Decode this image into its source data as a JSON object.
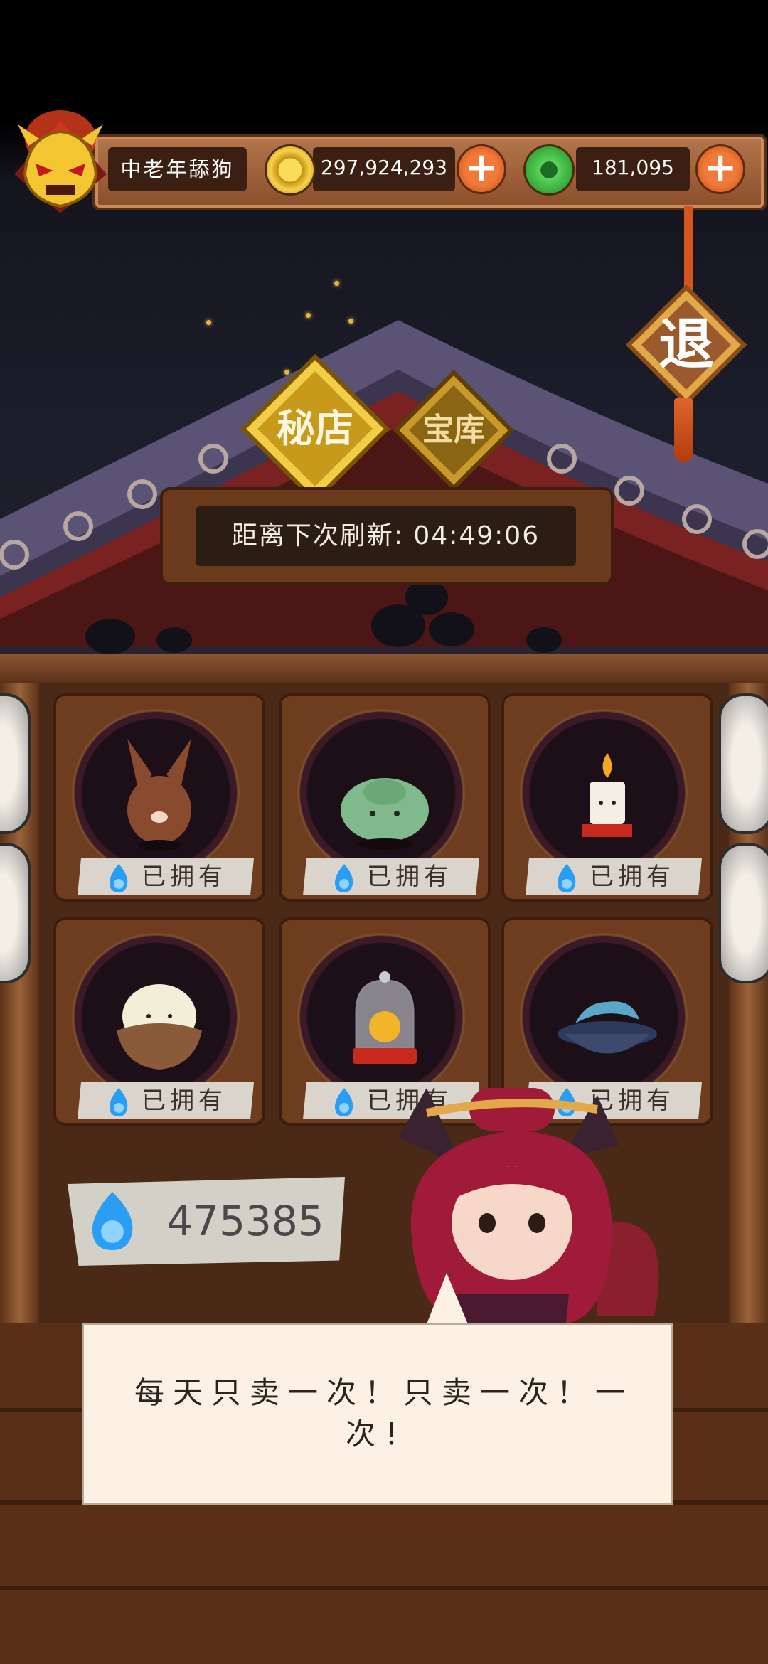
{
  "header": {
    "nickname": "中老年舔狗",
    "gold_amount": "297,924,293",
    "jade_amount": "181,095",
    "gold_plus": "+",
    "jade_plus": "+",
    "avatar_icon": "golden-demon-mask-icon",
    "gold_icon": "gold-coin-icon",
    "jade_icon": "jade-coin-icon"
  },
  "exit": {
    "label": "退"
  },
  "tabs": [
    {
      "label": "秘店",
      "active": true
    },
    {
      "label": "宝库",
      "active": false
    }
  ],
  "timer": {
    "text": "距离下次刷新: 04:49:06"
  },
  "items": [
    {
      "name": "brown-bunny-pet",
      "status": "已拥有"
    },
    {
      "name": "green-blob-pet",
      "status": "已拥有"
    },
    {
      "name": "candle-pet",
      "status": "已拥有"
    },
    {
      "name": "rice-bowl-pet",
      "status": "已拥有"
    },
    {
      "name": "bell-jar-chick-pet",
      "status": "已拥有"
    },
    {
      "name": "fish-bowl-pet",
      "status": "已拥有"
    }
  ],
  "currency": {
    "soul_amount": "475385",
    "icon": "blue-soul-flame-icon"
  },
  "dialog": {
    "text": "每天只卖一次！只卖一次！一次！"
  },
  "colors": {
    "wood": "#6e3d1f",
    "gold": "#e8b830",
    "soul": "#2a9df4",
    "accent": "#e0642a"
  }
}
